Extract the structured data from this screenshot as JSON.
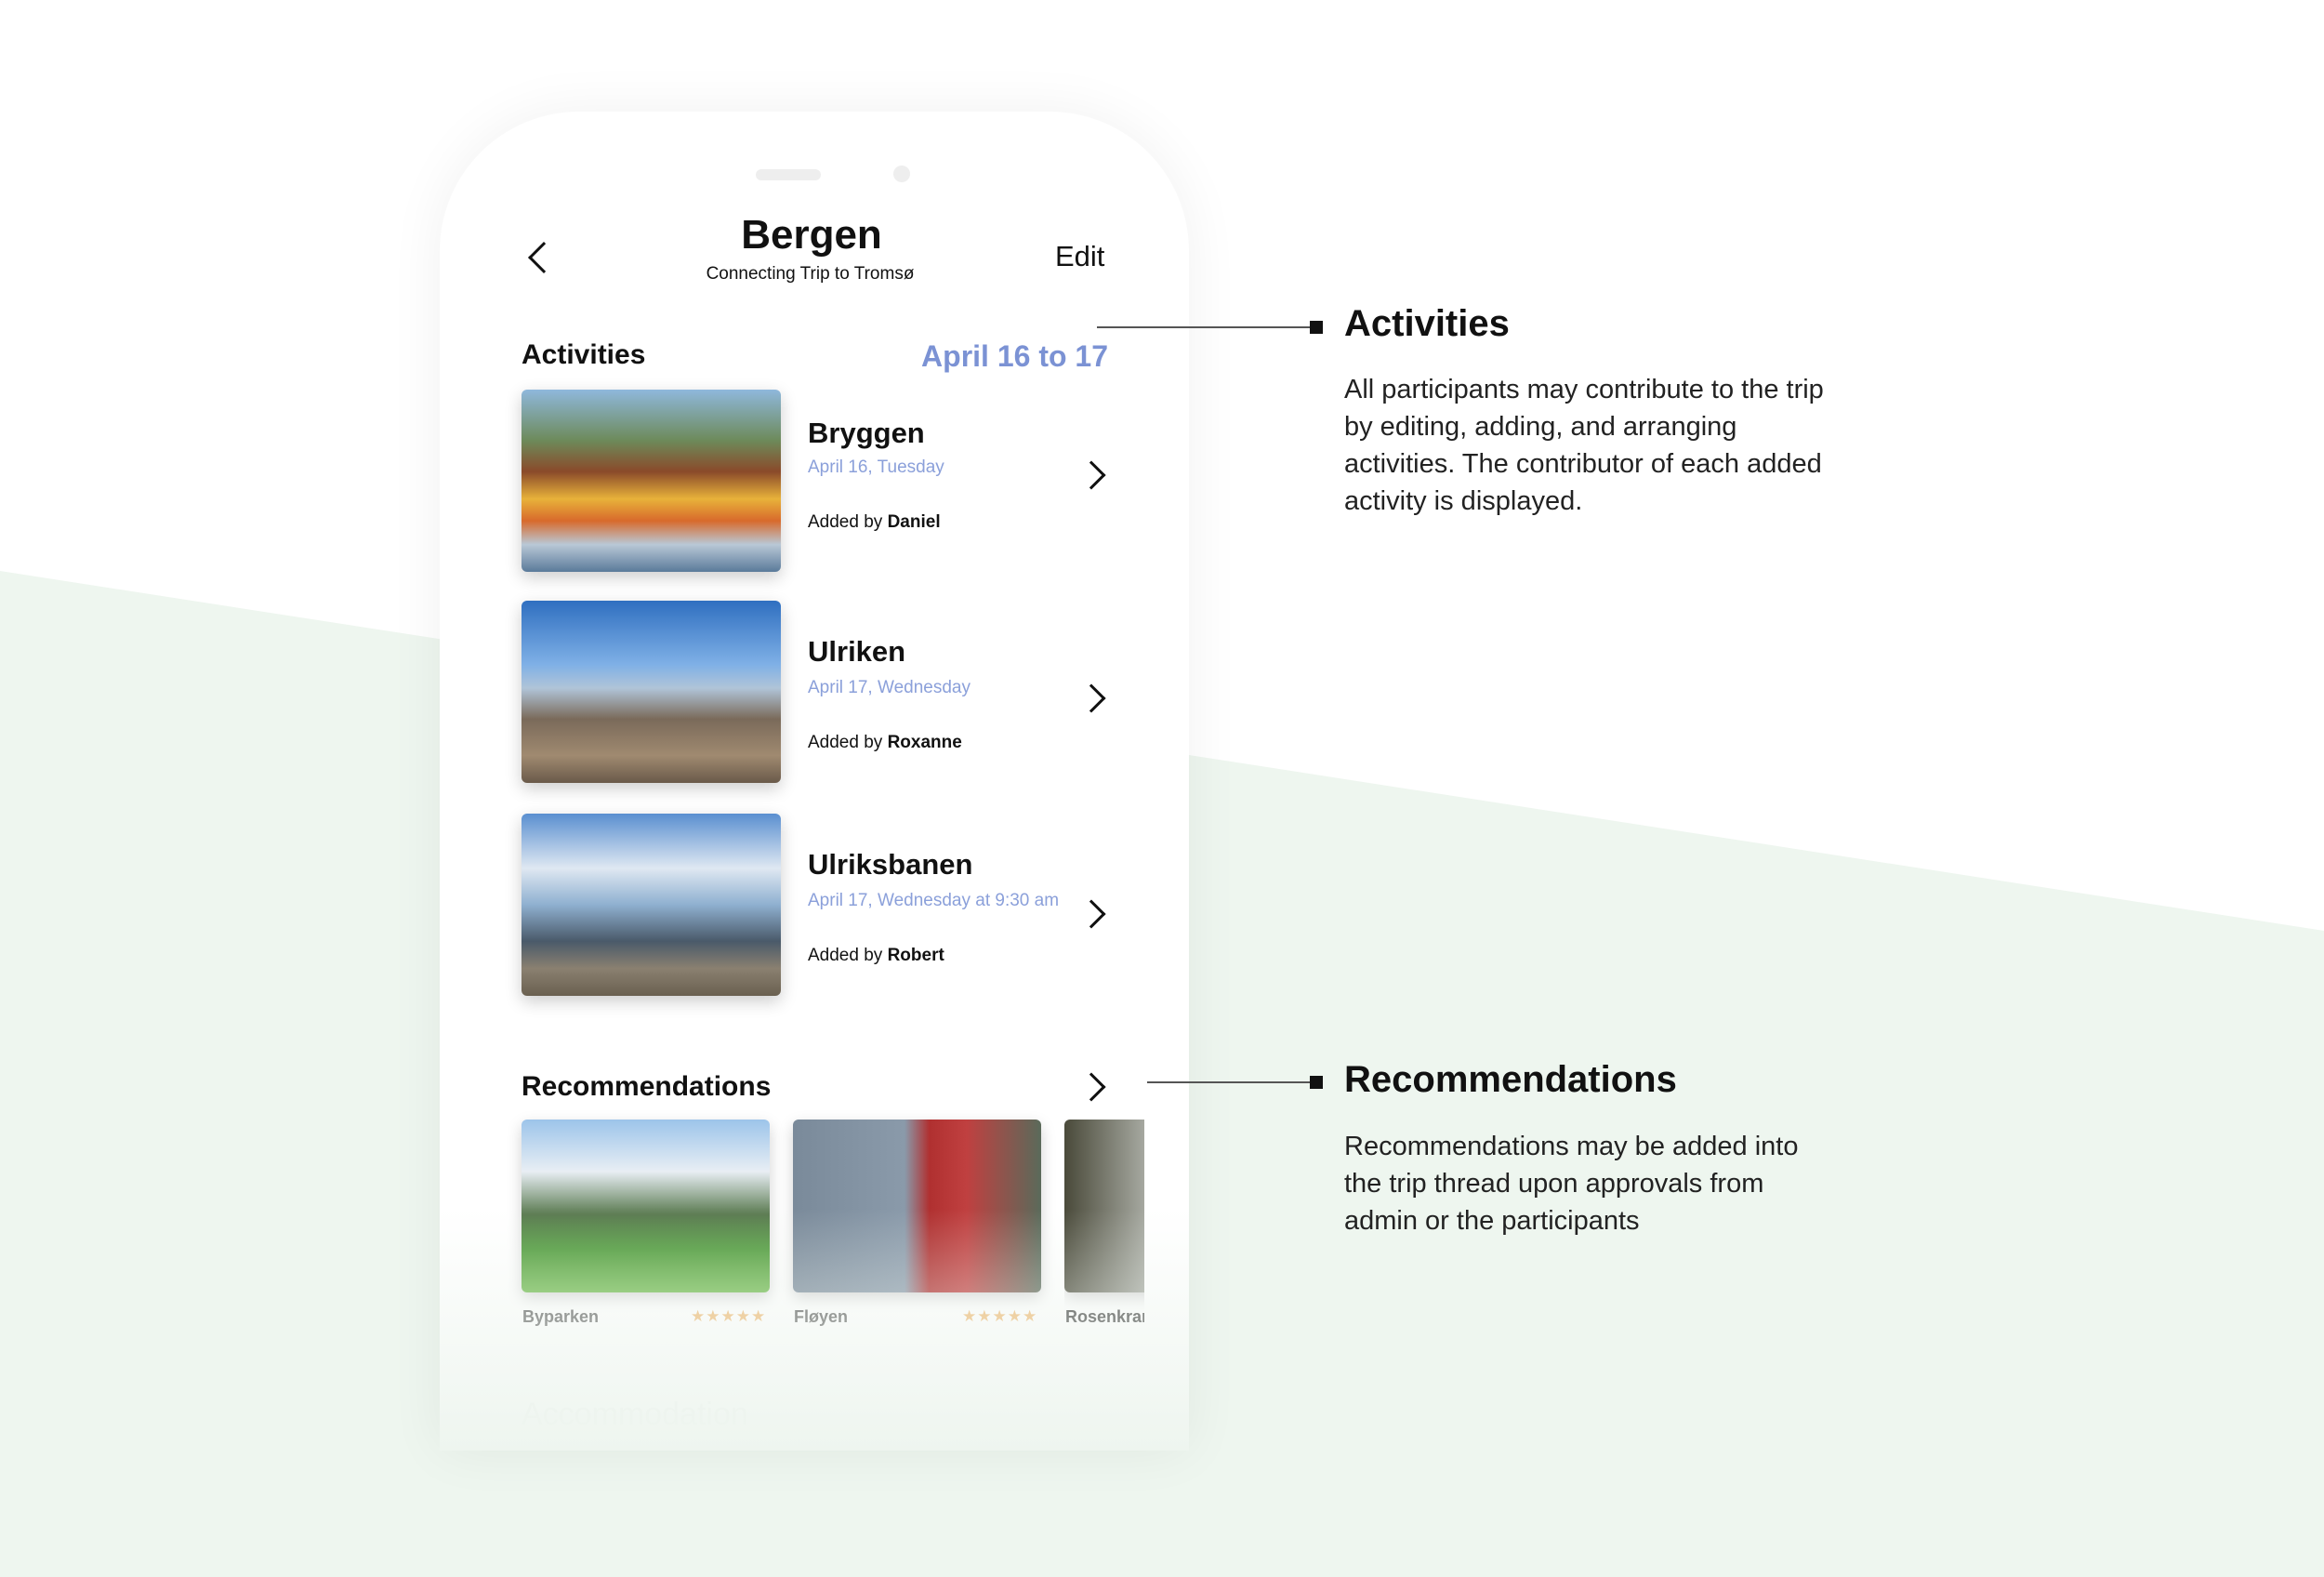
{
  "header": {
    "title": "Bergen",
    "subtitle": "Connecting Trip to Tromsø",
    "edit_label": "Edit"
  },
  "activities": {
    "label": "Activities",
    "date_range": "April 16 to 17",
    "added_by_prefix": "Added by",
    "items": [
      {
        "title": "Bryggen",
        "date": "April 16, Tuesday",
        "added_by": "Daniel"
      },
      {
        "title": "Ulriken",
        "date": "April 17, Wednesday",
        "added_by": "Roxanne"
      },
      {
        "title": "Ulriksbanen",
        "date": "April 17, Wednesday at 9:30 am",
        "added_by": "Robert"
      }
    ]
  },
  "recommendations": {
    "label": "Recommendations",
    "items": [
      {
        "name": "Byparken",
        "rating": 4.5,
        "stars": "★★★★★"
      },
      {
        "name": "Fløyen",
        "rating": 5,
        "stars": "★★★★★"
      },
      {
        "name": "Rosenkrantz"
      }
    ]
  },
  "accommodation": {
    "label": "Accommodation"
  },
  "annotations": [
    {
      "title": "Activities",
      "body": "All participants may contribute to the trip by editing, adding, and arranging activities. The contributor of each added activity is displayed."
    },
    {
      "title": "Recommendations",
      "body": "Recommendations may be added into the trip thread upon approvals from admin or the participants"
    }
  ],
  "colors": {
    "accent": "#7b92d4",
    "background_green": "#eef6ef",
    "star": "#efb56a"
  }
}
